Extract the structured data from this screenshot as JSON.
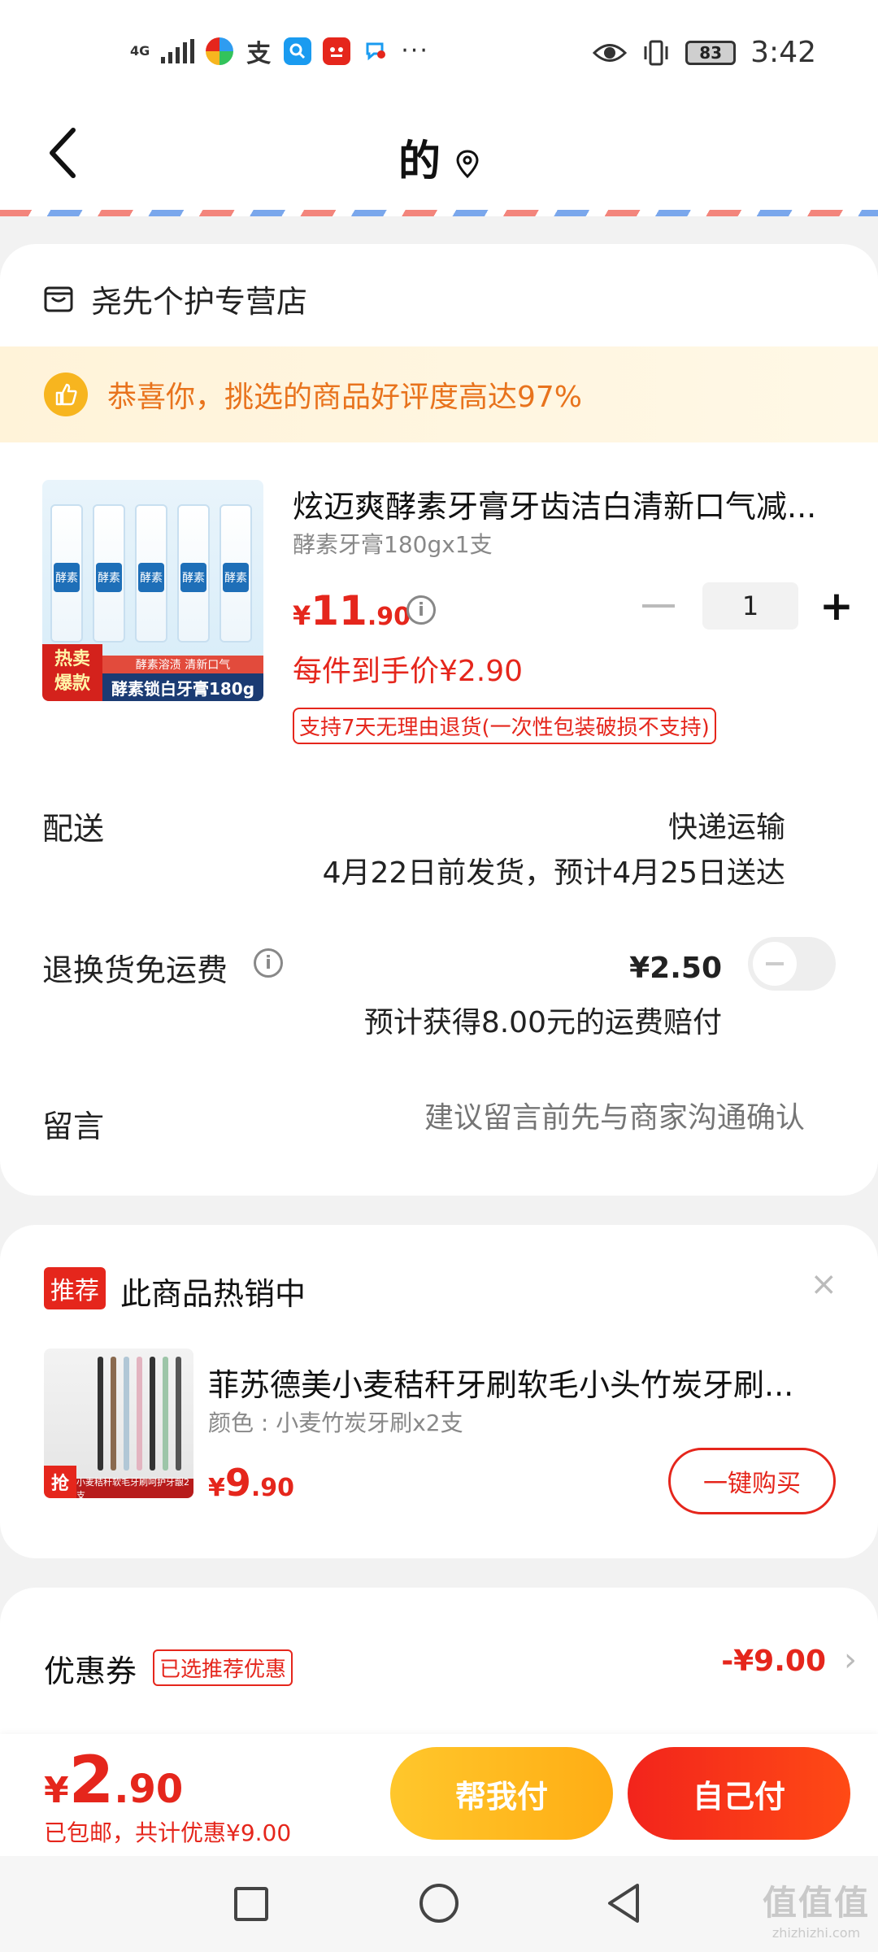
{
  "status_bar": {
    "network": "4G",
    "more": "···",
    "battery": "83",
    "time": "3:42"
  },
  "header": {
    "title": "的"
  },
  "order": {
    "shop_name": "尧先个护专营店",
    "praise_text": "恭喜你，挑选的商品好评度高达97%",
    "product": {
      "image_top_text": "酵素溶渍 清新口气",
      "image_banner": "酵素锁白牙膏180g",
      "image_hot_tag": "热卖\n爆款",
      "tube_label": "酵素",
      "title": "炫迈爽酵素牙膏牙齿洁白清新口气减...",
      "spec": "酵素牙膏180gx1支",
      "price_symbol": "¥",
      "price_int": "11",
      "price_dec": ".90",
      "quantity": "1",
      "unit_price": "每件到手价¥2.90",
      "return_policy": "支持7天无理由退货(一次性包装破损不支持)"
    },
    "delivery": {
      "label": "配送",
      "method": "快递运输",
      "eta": "4月22日前发货，预计4月25日送达"
    },
    "return_fee": {
      "label": "退换货免运费",
      "price": "¥2.50",
      "note": "预计获得8.00元的运费赔付",
      "enabled": false
    },
    "message": {
      "label": "留言",
      "placeholder": "建议留言前先与商家沟通确认"
    }
  },
  "recommend": {
    "badge": "推荐",
    "title": "此商品热销中",
    "close": "×",
    "product": {
      "image_corner": "抢",
      "image_strip": "小麦秸秆软毛牙刷呵护牙龈2支",
      "name": "菲苏德美小麦秸秆牙刷软毛小头竹炭牙刷...",
      "spec": "颜色 : 小麦竹炭牙刷x2支",
      "price_symbol": "¥",
      "price_int": "9",
      "price_dec": ".90",
      "buy_label": "一键购买"
    }
  },
  "coupon": {
    "label": "优惠券",
    "tag": "已选推荐优惠",
    "amount": "-¥9.00",
    "arrow": "›"
  },
  "bottom": {
    "total_symbol": "¥",
    "total_int": "2",
    "total_dec": ".90",
    "note": "已包邮，共计优惠¥9.00",
    "pay_friend": "帮我付",
    "pay_self": "自己付"
  },
  "watermark": {
    "main": "值值值",
    "sub": "zhizhizhi.com"
  },
  "colors": {
    "accent": "#e5261c",
    "praise": "#e8731d",
    "pay_friend": "#ffb71c",
    "pay_self": "#f2241c"
  }
}
